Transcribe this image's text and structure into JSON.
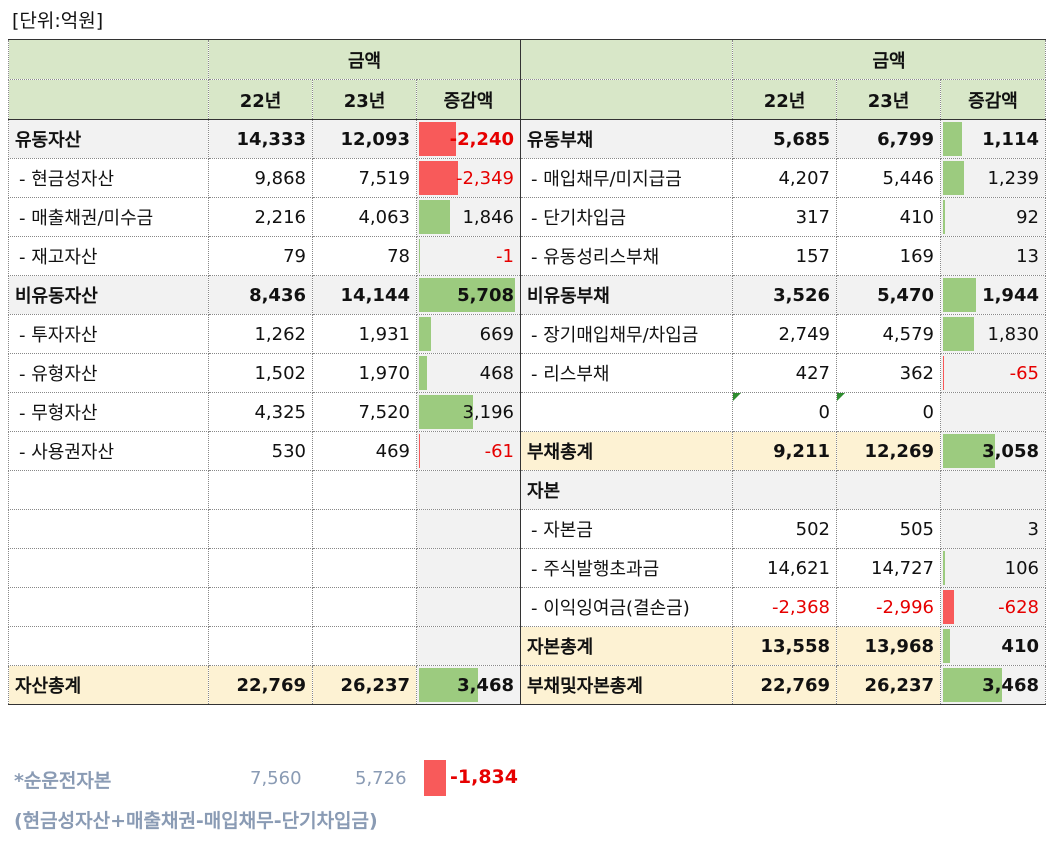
{
  "unit_label": "[단위:억원]",
  "header": {
    "amount": "금액",
    "y22": "22년",
    "y23": "23년",
    "diff": "증감액"
  },
  "left": [
    {
      "label": "유동자산",
      "y22": "14,333",
      "y23": "12,093",
      "diff": "-2,240",
      "level": -0.39,
      "style": "bold"
    },
    {
      "label": "- 현금성자산",
      "y22": "9,868",
      "y23": "7,519",
      "diff": "-2,349",
      "level": -0.41,
      "style": "sub"
    },
    {
      "label": "- 매출채권/미수금",
      "y22": "2,216",
      "y23": "4,063",
      "diff": "1,846",
      "level": 0.32,
      "style": "sub"
    },
    {
      "label": "- 재고자산",
      "y22": "79",
      "y23": "78",
      "diff": "-1",
      "level": 0,
      "style": "sub"
    },
    {
      "label": "비유동자산",
      "y22": "8,436",
      "y23": "14,144",
      "diff": "5,708",
      "level": 1.0,
      "style": "bold"
    },
    {
      "label": "- 투자자산",
      "y22": "1,262",
      "y23": "1,931",
      "diff": "669",
      "level": 0.12,
      "style": "sub"
    },
    {
      "label": "- 유형자산",
      "y22": "1,502",
      "y23": "1,970",
      "diff": "468",
      "level": 0.08,
      "style": "sub"
    },
    {
      "label": "- 무형자산",
      "y22": "4,325",
      "y23": "7,520",
      "diff": "3,196",
      "level": 0.56,
      "style": "sub"
    },
    {
      "label": "- 사용권자산",
      "y22": "530",
      "y23": "469",
      "diff": "-61",
      "level": -0.01,
      "style": "sub"
    },
    {
      "label": "",
      "y22": "",
      "y23": "",
      "diff": "",
      "level": 0,
      "style": "sub"
    },
    {
      "label": "",
      "y22": "",
      "y23": "",
      "diff": "",
      "level": 0,
      "style": "sub"
    },
    {
      "label": "",
      "y22": "",
      "y23": "",
      "diff": "",
      "level": 0,
      "style": "sub"
    },
    {
      "label": "",
      "y22": "",
      "y23": "",
      "diff": "",
      "level": 0,
      "style": "sub"
    },
    {
      "label": "",
      "y22": "",
      "y23": "",
      "diff": "",
      "level": 0,
      "style": "sub"
    },
    {
      "label": "자산총계",
      "y22": "22,769",
      "y23": "26,237",
      "diff": "3,468",
      "level": 0.61,
      "style": "total"
    }
  ],
  "right": [
    {
      "label": "유동부채",
      "y22": "5,685",
      "y23": "6,799",
      "diff": "1,114",
      "level": 0.2,
      "style": "bold"
    },
    {
      "label": "- 매입채무/미지급금",
      "y22": "4,207",
      "y23": "5,446",
      "diff": "1,239",
      "level": 0.22,
      "style": "sub"
    },
    {
      "label": "- 단기차입금",
      "y22": "317",
      "y23": "410",
      "diff": "92",
      "level": 0.02,
      "style": "sub"
    },
    {
      "label": "- 유동성리스부채",
      "y22": "157",
      "y23": "169",
      "diff": "13",
      "level": 0,
      "style": "sub"
    },
    {
      "label": "비유동부채",
      "y22": "3,526",
      "y23": "5,470",
      "diff": "1,944",
      "level": 0.34,
      "style": "bold"
    },
    {
      "label": "- 장기매입채무/차입금",
      "y22": "2,749",
      "y23": "4,579",
      "diff": "1,830",
      "level": 0.32,
      "style": "sub"
    },
    {
      "label": "- 리스부채",
      "y22": "427",
      "y23": "362",
      "diff": "-65",
      "level": -0.01,
      "style": "sub"
    },
    {
      "label": "",
      "y22": "0",
      "y23": "0",
      "diff": "",
      "level": 0,
      "style": "sub"
    },
    {
      "label": "부채총계",
      "y22": "9,211",
      "y23": "12,269",
      "diff": "3,058",
      "level": 0.54,
      "style": "total"
    },
    {
      "label": "자본",
      "y22": "",
      "y23": "",
      "diff": "",
      "level": 0,
      "style": "bold"
    },
    {
      "label": "- 자본금",
      "y22": "502",
      "y23": "505",
      "diff": "3",
      "level": 0,
      "style": "sub"
    },
    {
      "label": "- 주식발행초과금",
      "y22": "14,621",
      "y23": "14,727",
      "diff": "106",
      "level": 0.02,
      "style": "sub"
    },
    {
      "label": "- 이익잉여금(결손금)",
      "y22": "-2,368",
      "y23": "-2,996",
      "diff": "-628",
      "level": -0.11,
      "style": "sub"
    },
    {
      "label": "자본총계",
      "y22": "13,558",
      "y23": "13,968",
      "diff": "410",
      "level": 0.07,
      "style": "total"
    },
    {
      "label": "부채및자본총계",
      "y22": "22,769",
      "y23": "26,237",
      "diff": "3,468",
      "level": 0.61,
      "style": "total"
    }
  ],
  "footnote": {
    "label": "*순운전자본",
    "y22": "7,560",
    "y23": "5,726",
    "diff": "-1,834",
    "formula": "(현금성자산+매출채권-매입채무-단기차입금)"
  }
}
